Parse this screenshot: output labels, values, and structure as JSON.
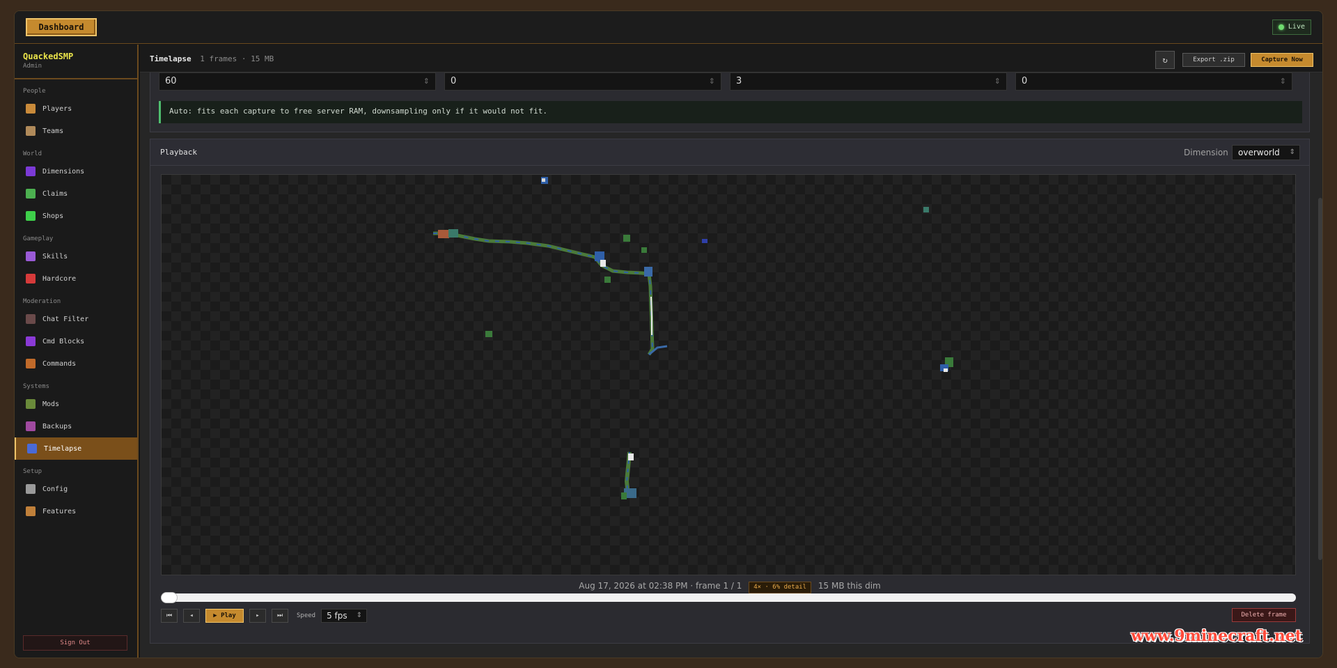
{
  "topbar": {
    "dashboard_label": "Dashboard",
    "live_label": "Live"
  },
  "brand": {
    "name": "QuackedSMP",
    "role": "Admin"
  },
  "sidebar": {
    "sections": [
      {
        "label": "People",
        "items": [
          {
            "label": "Players",
            "icon": "player-head-icon",
            "color": "#c98a3a"
          },
          {
            "label": "Teams",
            "icon": "sword-icon",
            "color": "#b08a5a"
          }
        ]
      },
      {
        "label": "World",
        "items": [
          {
            "label": "Dimensions",
            "icon": "portal-icon",
            "color": "#7b3ad6"
          },
          {
            "label": "Claims",
            "icon": "flag-icon",
            "color": "#4caf50"
          },
          {
            "label": "Shops",
            "icon": "emerald-icon",
            "color": "#3ecf4a"
          }
        ]
      },
      {
        "label": "Gameplay",
        "items": [
          {
            "label": "Skills",
            "icon": "skills-icon",
            "color": "#9a5ad6"
          },
          {
            "label": "Hardcore",
            "icon": "heart-icon",
            "color": "#d63a3a"
          }
        ]
      },
      {
        "label": "Moderation",
        "items": [
          {
            "label": "Chat Filter",
            "icon": "chat-filter-icon",
            "color": "#6a4a4a"
          },
          {
            "label": "Cmd Blocks",
            "icon": "command-block-icon",
            "color": "#8a3ad6"
          },
          {
            "label": "Commands",
            "icon": "commands-icon",
            "color": "#c06a2a"
          }
        ]
      },
      {
        "label": "Systems",
        "items": [
          {
            "label": "Mods",
            "icon": "mods-icon",
            "color": "#6a8a3a"
          },
          {
            "label": "Backups",
            "icon": "backups-icon",
            "color": "#a04aa0"
          },
          {
            "label": "Timelapse",
            "icon": "timelapse-icon",
            "color": "#4a6ad6",
            "active": true
          }
        ]
      },
      {
        "label": "Setup",
        "items": [
          {
            "label": "Config",
            "icon": "gear-icon",
            "color": "#9a9a9a"
          },
          {
            "label": "Features",
            "icon": "features-icon",
            "color": "#c0803a"
          }
        ]
      }
    ],
    "signout_label": "Sign Out"
  },
  "header": {
    "title": "Timelapse",
    "meta": "1 frames · 15 MB",
    "export_label": "Export .zip",
    "capture_label": "Capture Now",
    "refresh_glyph": "↻"
  },
  "settings": {
    "inputs": [
      "60",
      "0",
      "3",
      "0"
    ],
    "note": "Auto: fits each capture to free server RAM, downsampling only if it would not fit."
  },
  "playback": {
    "title": "Playback",
    "dimension_label": "Dimension",
    "dimension_value": "overworld",
    "frame_info": "Aug 17, 2026 at 02:38 PM · frame 1 / 1",
    "detail_badge": "4× · 6% detail",
    "size_info": "15 MB this dim",
    "slider_position": 0,
    "controls": {
      "first": "⏮",
      "prev": "◂",
      "play": "▶ Play",
      "next": "▸",
      "last": "⏭"
    },
    "speed_label": "Speed",
    "speed_value": "5 fps",
    "delete_label": "Delete frame"
  },
  "watermark": "www.9minecraft.net"
}
